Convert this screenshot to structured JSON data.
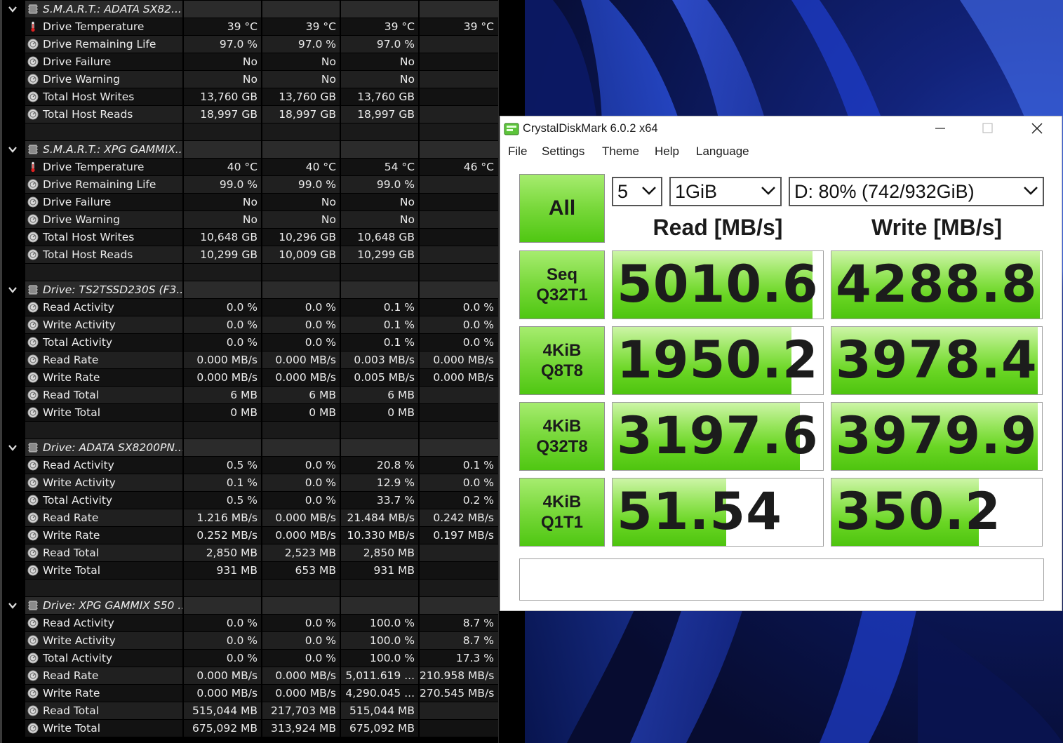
{
  "sensors": {
    "groups": [
      {
        "title": "S.M.A.R.T.: ADATA SX82...",
        "rows": [
          {
            "icon": "thermometer-icon",
            "name": "Drive Temperature",
            "values": [
              "39 °C",
              "39 °C",
              "39 °C",
              "39 °C"
            ]
          },
          {
            "icon": "sensor-circle-icon",
            "name": "Drive Remaining Life",
            "values": [
              "97.0 %",
              "97.0 %",
              "97.0 %",
              ""
            ]
          },
          {
            "icon": "sensor-circle-icon",
            "name": "Drive Failure",
            "values": [
              "No",
              "No",
              "No",
              ""
            ]
          },
          {
            "icon": "sensor-circle-icon",
            "name": "Drive Warning",
            "values": [
              "No",
              "No",
              "No",
              ""
            ]
          },
          {
            "icon": "sensor-circle-icon",
            "name": "Total Host Writes",
            "values": [
              "13,760 GB",
              "13,760 GB",
              "13,760 GB",
              ""
            ]
          },
          {
            "icon": "sensor-circle-icon",
            "name": "Total Host Reads",
            "values": [
              "18,997 GB",
              "18,997 GB",
              "18,997 GB",
              ""
            ]
          }
        ]
      },
      {
        "title": "S.M.A.R.T.: XPG GAMMIX...",
        "rows": [
          {
            "icon": "thermometer-icon",
            "name": "Drive Temperature",
            "values": [
              "40 °C",
              "40 °C",
              "54 °C",
              "46 °C"
            ]
          },
          {
            "icon": "sensor-circle-icon",
            "name": "Drive Remaining Life",
            "values": [
              "99.0 %",
              "99.0 %",
              "99.0 %",
              ""
            ]
          },
          {
            "icon": "sensor-circle-icon",
            "name": "Drive Failure",
            "values": [
              "No",
              "No",
              "No",
              ""
            ]
          },
          {
            "icon": "sensor-circle-icon",
            "name": "Drive Warning",
            "values": [
              "No",
              "No",
              "No",
              ""
            ]
          },
          {
            "icon": "sensor-circle-icon",
            "name": "Total Host Writes",
            "values": [
              "10,648 GB",
              "10,296 GB",
              "10,648 GB",
              ""
            ]
          },
          {
            "icon": "sensor-circle-icon",
            "name": "Total Host Reads",
            "values": [
              "10,299 GB",
              "10,009 GB",
              "10,299 GB",
              ""
            ]
          }
        ]
      },
      {
        "title": "Drive: TS2TSSD230S (F3...",
        "rows": [
          {
            "icon": "sensor-circle-icon",
            "name": "Read Activity",
            "values": [
              "0.0 %",
              "0.0 %",
              "0.1 %",
              "0.0 %"
            ]
          },
          {
            "icon": "sensor-circle-icon",
            "name": "Write Activity",
            "values": [
              "0.0 %",
              "0.0 %",
              "0.1 %",
              "0.0 %"
            ]
          },
          {
            "icon": "sensor-circle-icon",
            "name": "Total Activity",
            "values": [
              "0.0 %",
              "0.0 %",
              "0.1 %",
              "0.0 %"
            ]
          },
          {
            "icon": "sensor-circle-icon",
            "name": "Read Rate",
            "values": [
              "0.000 MB/s",
              "0.000 MB/s",
              "0.003 MB/s",
              "0.000 MB/s"
            ]
          },
          {
            "icon": "sensor-circle-icon",
            "name": "Write Rate",
            "values": [
              "0.000 MB/s",
              "0.000 MB/s",
              "0.005 MB/s",
              "0.000 MB/s"
            ]
          },
          {
            "icon": "sensor-circle-icon",
            "name": "Read Total",
            "values": [
              "6 MB",
              "6 MB",
              "6 MB",
              ""
            ]
          },
          {
            "icon": "sensor-circle-icon",
            "name": "Write Total",
            "values": [
              "0 MB",
              "0 MB",
              "0 MB",
              ""
            ]
          }
        ]
      },
      {
        "title": "Drive: ADATA SX8200PN...",
        "rows": [
          {
            "icon": "sensor-circle-icon",
            "name": "Read Activity",
            "values": [
              "0.5 %",
              "0.0 %",
              "20.8 %",
              "0.1 %"
            ]
          },
          {
            "icon": "sensor-circle-icon",
            "name": "Write Activity",
            "values": [
              "0.1 %",
              "0.0 %",
              "12.9 %",
              "0.0 %"
            ]
          },
          {
            "icon": "sensor-circle-icon",
            "name": "Total Activity",
            "values": [
              "0.5 %",
              "0.0 %",
              "33.7 %",
              "0.2 %"
            ]
          },
          {
            "icon": "sensor-circle-icon",
            "name": "Read Rate",
            "values": [
              "1.216 MB/s",
              "0.000 MB/s",
              "21.484 MB/s",
              "0.242 MB/s"
            ]
          },
          {
            "icon": "sensor-circle-icon",
            "name": "Write Rate",
            "values": [
              "0.252 MB/s",
              "0.000 MB/s",
              "10.330 MB/s",
              "0.197 MB/s"
            ]
          },
          {
            "icon": "sensor-circle-icon",
            "name": "Read Total",
            "values": [
              "2,850 MB",
              "2,523 MB",
              "2,850 MB",
              ""
            ]
          },
          {
            "icon": "sensor-circle-icon",
            "name": "Write Total",
            "values": [
              "931 MB",
              "653 MB",
              "931 MB",
              ""
            ]
          }
        ]
      },
      {
        "title": "Drive: XPG GAMMIX S50 ...",
        "rows": [
          {
            "icon": "sensor-circle-icon",
            "name": "Read Activity",
            "values": [
              "0.0 %",
              "0.0 %",
              "100.0 %",
              "8.7 %"
            ]
          },
          {
            "icon": "sensor-circle-icon",
            "name": "Write Activity",
            "values": [
              "0.0 %",
              "0.0 %",
              "100.0 %",
              "8.7 %"
            ]
          },
          {
            "icon": "sensor-circle-icon",
            "name": "Total Activity",
            "values": [
              "0.0 %",
              "0.0 %",
              "100.0 %",
              "17.3 %"
            ]
          },
          {
            "icon": "sensor-circle-icon",
            "name": "Read Rate",
            "values": [
              "0.000 MB/s",
              "0.000 MB/s",
              "5,011.619 ...",
              "210.958 MB/s"
            ]
          },
          {
            "icon": "sensor-circle-icon",
            "name": "Write Rate",
            "values": [
              "0.000 MB/s",
              "0.000 MB/s",
              "4,290.045 ...",
              "270.545 MB/s"
            ]
          },
          {
            "icon": "sensor-circle-icon",
            "name": "Read Total",
            "values": [
              "515,044 MB",
              "217,703 MB",
              "515,044 MB",
              ""
            ]
          },
          {
            "icon": "sensor-circle-icon",
            "name": "Write Total",
            "values": [
              "675,092 MB",
              "313,924 MB",
              "675,092 MB",
              ""
            ]
          }
        ]
      }
    ]
  },
  "cdm": {
    "title": "CrystalDiskMark 6.0.2 x64",
    "menu": [
      "File",
      "Settings",
      "Theme",
      "Help",
      "Language"
    ],
    "all_label": "All",
    "count": "5",
    "size": "1GiB",
    "drive": "D: 80% (742/932GiB)",
    "read_header": "Read [MB/s]",
    "write_header": "Write [MB/s]",
    "tests": [
      {
        "line1": "Seq",
        "line2": "Q32T1",
        "read": "5010.6",
        "write": "4288.8",
        "read_fill": 0.95,
        "write_fill": 0.99
      },
      {
        "line1": "4KiB",
        "line2": "Q8T8",
        "read": "1950.2",
        "write": "3978.4",
        "read_fill": 0.85,
        "write_fill": 0.98
      },
      {
        "line1": "4KiB",
        "line2": "Q32T8",
        "read": "3197.6",
        "write": "3979.9",
        "read_fill": 0.89,
        "write_fill": 0.98
      },
      {
        "line1": "4KiB",
        "line2": "Q1T1",
        "read": "51.54",
        "write": "350.2",
        "read_fill": 0.54,
        "write_fill": 0.7
      }
    ],
    "comment": "",
    "colors": {
      "accent_green": "#4ec40f",
      "window_bg": "#ffffff"
    }
  }
}
